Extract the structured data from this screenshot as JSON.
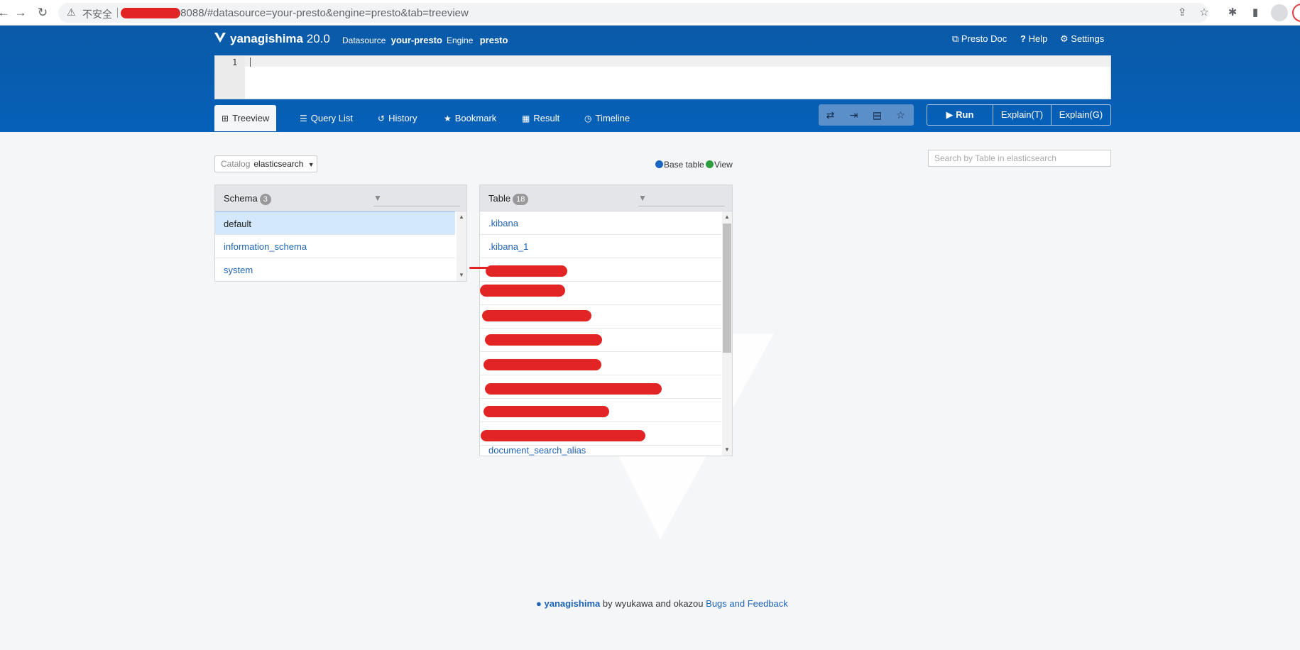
{
  "browser": {
    "insecure_label": "不安全",
    "url": ":8088/#datasource=your-presto&engine=presto&tab=treeview"
  },
  "header": {
    "app_name": "yanagishima",
    "version": "20.0",
    "datasource_label": "Datasource",
    "datasource_value": "your-presto",
    "engine_label": "Engine",
    "engine_value": "presto",
    "presto_doc": "Presto Doc",
    "help": "Help",
    "settings": "Settings"
  },
  "editor": {
    "line_number": "1"
  },
  "tabs": [
    {
      "label": "Treeview",
      "icon": "sitemap-icon",
      "active": true
    },
    {
      "label": "Query List",
      "icon": "list-icon"
    },
    {
      "label": "History",
      "icon": "history-icon"
    },
    {
      "label": "Bookmark",
      "icon": "star-icon"
    },
    {
      "label": "Result",
      "icon": "table-icon"
    },
    {
      "label": "Timeline",
      "icon": "clock-icon"
    }
  ],
  "toolbar": {
    "icons": [
      "exchange-icon",
      "indent-icon",
      "clipboard-icon",
      "star-outline-icon"
    ],
    "run": "Run",
    "explain_t": "Explain(T)",
    "explain_g": "Explain(G)"
  },
  "catalog": {
    "label": "Catalog",
    "value": "elasticsearch"
  },
  "legend": {
    "base_table": "Base table",
    "view": "View",
    "base_color": "#1a66c2",
    "view_color": "#2e9e3f"
  },
  "search_placeholder": "Search by Table in elasticsearch",
  "schema_panel": {
    "title": "Schema",
    "count": "3",
    "items": [
      "default",
      "information_schema",
      "system"
    ]
  },
  "table_panel": {
    "title": "Table",
    "count": "18",
    "items": [
      ".kibana",
      ".kibana_1",
      "",
      "",
      "",
      "",
      "",
      "",
      "",
      "",
      "document_search_alias"
    ]
  },
  "footer": {
    "brand": "yanagishima",
    "by_text": "by wyukawa and okazou",
    "bugs_link": "Bugs and Feedback"
  },
  "colors": {
    "brand_blue": "#0660b8",
    "link": "#1e64b4",
    "redaction": "#e32424"
  }
}
